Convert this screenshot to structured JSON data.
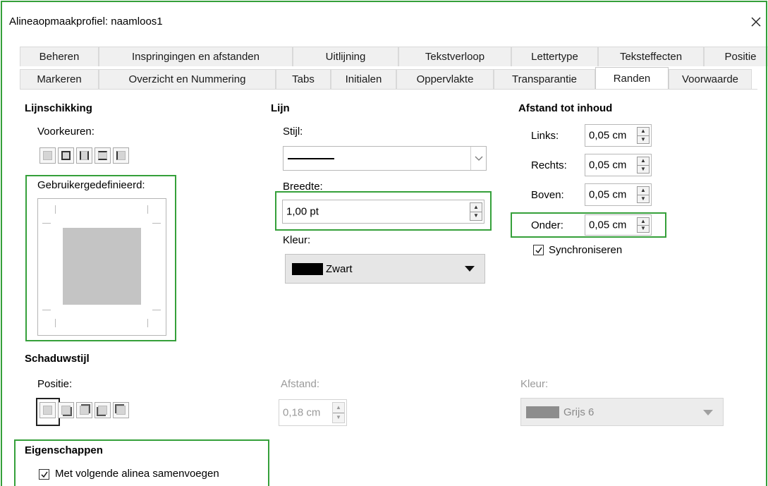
{
  "window": {
    "title": "Alineaopmaakprofiel: naamloos1",
    "close_glyph": "✕"
  },
  "tabs_row1": [
    "Beheren",
    "Inspringingen en afstanden",
    "Uitlijning",
    "Tekstverloop",
    "Lettertype",
    "Teksteffecten",
    "Positie"
  ],
  "tabs_row2": [
    "Markeren",
    "Overzicht en Nummering",
    "Tabs",
    "Initialen",
    "Oppervlakte",
    "Transparantie",
    "Randen",
    "Voorwaarde"
  ],
  "active_tab": "Randen",
  "line_arrangement": {
    "title": "Lijnschikking",
    "presets_label": "Voorkeuren:",
    "user_defined_label": "Gebruikergedefinieerd:"
  },
  "line": {
    "title": "Lijn",
    "style_label": "Stijl:",
    "width_label": "Breedte:",
    "width_value": "1,00 pt",
    "color_label": "Kleur:",
    "color_value": "Zwart",
    "color_hex": "#000000"
  },
  "padding": {
    "title": "Afstand tot inhoud",
    "left_label": "Links:",
    "left_value": "0,05 cm",
    "right_label": "Rechts:",
    "right_value": "0,05 cm",
    "top_label": "Boven:",
    "top_value": "0,05 cm",
    "bottom_label": "Onder:",
    "bottom_value": "0,05 cm",
    "sync_label": "Synchroniseren",
    "sync_checked": true
  },
  "shadow": {
    "title": "Schaduwstijl",
    "position_label": "Positie:",
    "distance_label": "Afstand:",
    "distance_value": "0,18 cm",
    "color_label": "Kleur:",
    "color_value": "Grijs 6",
    "color_hex": "#808080"
  },
  "properties": {
    "title": "Eigenschappen",
    "merge_label": "Met volgende alinea samenvoegen",
    "merge_checked": true
  },
  "colors": {
    "highlight": "#35a03a"
  }
}
